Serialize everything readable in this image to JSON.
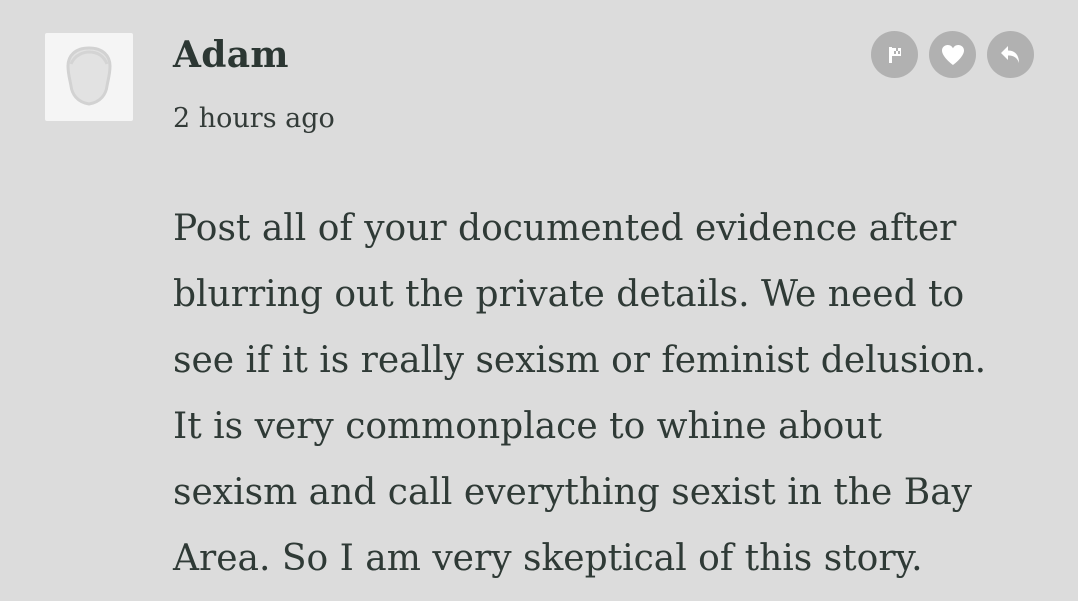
{
  "comment": {
    "author": "Adam",
    "timestamp": "2 hours ago",
    "avatar_icon": "default-user-silhouette-icon",
    "actions": [
      {
        "name": "flag-button",
        "icon": "flag-icon"
      },
      {
        "name": "like-button",
        "icon": "heart-icon"
      },
      {
        "name": "reply-button",
        "icon": "reply-arrow-icon"
      }
    ],
    "body_lines": [
      "Post all of your documented evidence after",
      "blurring out the private details. We need to",
      "see if it is really sexism or feminist delusion.",
      "It is very commonplace to whine about",
      "sexism and call everything sexist in the Bay",
      "Area. So I am very skeptical of this story."
    ]
  },
  "colors": {
    "background": "#dcdcdc",
    "text": "#2f3a36",
    "icon_button": "#b1b1b1",
    "avatar_bg": "#f5f5f5"
  }
}
